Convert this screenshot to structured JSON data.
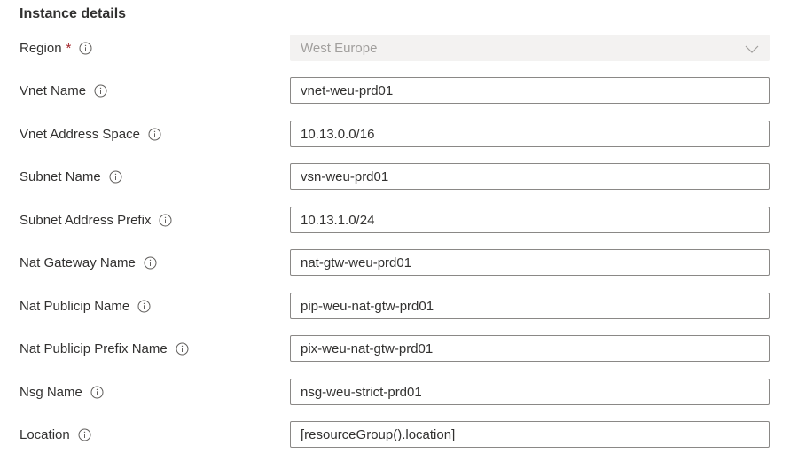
{
  "section": {
    "title": "Instance details"
  },
  "fields": [
    {
      "label": "Region",
      "required": "*",
      "value": "West Europe",
      "type": "select",
      "disabled": true,
      "icon": "info-icon"
    },
    {
      "label": "Vnet Name",
      "value": "vnet-weu-prd01",
      "type": "text",
      "icon": "info-icon"
    },
    {
      "label": "Vnet Address Space",
      "value": "10.13.0.0/16",
      "type": "text",
      "icon": "info-icon"
    },
    {
      "label": "Subnet Name",
      "value": "vsn-weu-prd01",
      "type": "text",
      "icon": "info-icon"
    },
    {
      "label": "Subnet Address Prefix",
      "value": "10.13.1.0/24",
      "type": "text",
      "icon": "info-icon"
    },
    {
      "label": "Nat Gateway Name",
      "value": "nat-gtw-weu-prd01",
      "type": "text",
      "icon": "info-icon"
    },
    {
      "label": "Nat Publicip Name",
      "value": "pip-weu-nat-gtw-prd01",
      "type": "text",
      "icon": "info-icon"
    },
    {
      "label": "Nat Publicip Prefix Name",
      "value": "pix-weu-nat-gtw-prd01",
      "type": "text",
      "icon": "info-icon"
    },
    {
      "label": "Nsg Name",
      "value": "nsg-weu-strict-prd01",
      "type": "text",
      "icon": "info-icon"
    },
    {
      "label": "Location",
      "value": "[resourceGroup().location]",
      "type": "text",
      "icon": "info-icon"
    }
  ],
  "colors": {
    "text": "#323130",
    "required": "#a4262c",
    "border": "#8a8886",
    "disabled_bg": "#f3f2f1",
    "disabled_text": "#a19f9d"
  }
}
